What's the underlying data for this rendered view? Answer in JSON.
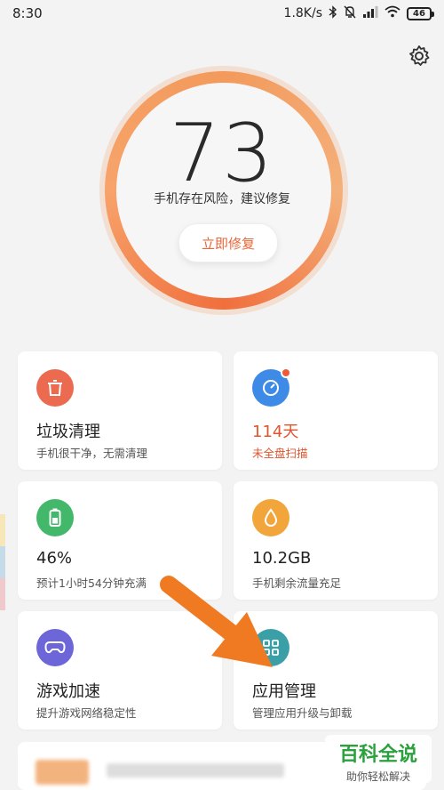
{
  "status_bar": {
    "time": "8:30",
    "speed": "1.8K/s",
    "battery": "46"
  },
  "header": {
    "score": "73",
    "risk_text": "手机存在风险，建议修复",
    "fix_button_label": "立即修复"
  },
  "cards": [
    {
      "title": "垃圾清理",
      "subtitle": "手机很干净，无需清理",
      "icon": "trash-icon",
      "color": "#ec6a4f"
    },
    {
      "title": "114天",
      "subtitle": "未全盘扫描",
      "icon": "scan-icon",
      "color": "#3d8be6",
      "accent": "#e0552e"
    },
    {
      "title": "46%",
      "subtitle": "预计1小时54分钟充满",
      "icon": "battery-icon",
      "color": "#43b76a"
    },
    {
      "title": "10.2GB",
      "subtitle": "手机剩余流量充足",
      "icon": "data-drop-icon",
      "color": "#f1a53a"
    },
    {
      "title": "游戏加速",
      "subtitle": "提升游戏网络稳定性",
      "icon": "gamepad-icon",
      "color": "#6c66d9"
    },
    {
      "title": "应用管理",
      "subtitle": "管理应用升级与卸载",
      "icon": "app-grid-icon",
      "color": "#3a9fa6"
    }
  ],
  "watermark": {
    "title": "百科全说",
    "subtitle": "助你轻松解决"
  },
  "colors": {
    "accent": "#e8663a",
    "arrow": "#f07a22"
  }
}
